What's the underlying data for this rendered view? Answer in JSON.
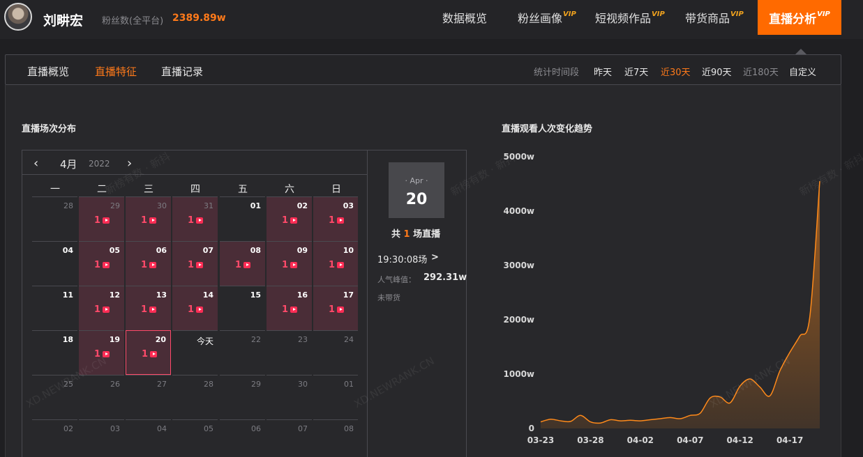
{
  "header": {
    "username": "刘畊宏",
    "fans_label": "粉丝数(全平台)",
    "fans_value": "2389.89w",
    "nav": [
      {
        "label": "数据概览",
        "vip": ""
      },
      {
        "label": "粉丝画像",
        "vip": "VIP"
      },
      {
        "label": "短视频作品",
        "vip": "VIP"
      },
      {
        "label": "带货商品",
        "vip": "VIP"
      },
      {
        "label": "直播分析",
        "vip": "VIP"
      }
    ]
  },
  "subnav": {
    "tabs": [
      "直播概览",
      "直播特征",
      "直播记录"
    ],
    "range_label": "统计时间段",
    "ranges": [
      "昨天",
      "近7天",
      "近30天",
      "近90天",
      "近180天",
      "自定义"
    ]
  },
  "calendar": {
    "title": "直播场次分布",
    "prev": "‹",
    "next": "›",
    "month": "4月",
    "year": "2022",
    "weekdays": [
      "一",
      "二",
      "三",
      "四",
      "五",
      "六",
      "日"
    ],
    "today_label": "今天",
    "live_count": "1",
    "days": [
      {
        "n": "28",
        "faded": true,
        "live": false
      },
      {
        "n": "29",
        "faded": true,
        "live": true
      },
      {
        "n": "30",
        "faded": true,
        "live": true
      },
      {
        "n": "31",
        "faded": true,
        "live": true
      },
      {
        "n": "01",
        "faded": false,
        "live": false
      },
      {
        "n": "02",
        "faded": false,
        "live": true
      },
      {
        "n": "03",
        "faded": false,
        "live": true
      },
      {
        "n": "04",
        "faded": false,
        "live": false
      },
      {
        "n": "05",
        "faded": false,
        "live": true
      },
      {
        "n": "06",
        "faded": false,
        "live": true
      },
      {
        "n": "07",
        "faded": false,
        "live": true
      },
      {
        "n": "08",
        "faded": false,
        "live": true
      },
      {
        "n": "09",
        "faded": false,
        "live": true
      },
      {
        "n": "10",
        "faded": false,
        "live": true
      },
      {
        "n": "11",
        "faded": false,
        "live": false
      },
      {
        "n": "12",
        "faded": false,
        "live": true
      },
      {
        "n": "13",
        "faded": false,
        "live": true
      },
      {
        "n": "14",
        "faded": false,
        "live": true
      },
      {
        "n": "15",
        "faded": false,
        "live": false
      },
      {
        "n": "16",
        "faded": false,
        "live": true
      },
      {
        "n": "17",
        "faded": false,
        "live": true
      },
      {
        "n": "18",
        "faded": false,
        "live": false
      },
      {
        "n": "19",
        "faded": false,
        "live": true
      },
      {
        "n": "20",
        "faded": false,
        "live": true,
        "selected": true
      },
      {
        "n": "今天",
        "faded": false,
        "live": false,
        "today": true
      },
      {
        "n": "22",
        "faded": true,
        "live": false
      },
      {
        "n": "23",
        "faded": true,
        "live": false
      },
      {
        "n": "24",
        "faded": true,
        "live": false
      },
      {
        "n": "25",
        "faded": true,
        "live": false
      },
      {
        "n": "26",
        "faded": true,
        "live": false
      },
      {
        "n": "27",
        "faded": true,
        "live": false
      },
      {
        "n": "28",
        "faded": true,
        "live": false
      },
      {
        "n": "29",
        "faded": true,
        "live": false
      },
      {
        "n": "30",
        "faded": true,
        "live": false
      },
      {
        "n": "01",
        "faded": true,
        "live": false
      },
      {
        "n": "02",
        "faded": true,
        "live": false
      },
      {
        "n": "03",
        "faded": true,
        "live": false
      },
      {
        "n": "04",
        "faded": true,
        "live": false
      },
      {
        "n": "05",
        "faded": true,
        "live": false
      },
      {
        "n": "06",
        "faded": true,
        "live": false
      },
      {
        "n": "07",
        "faded": true,
        "live": false
      },
      {
        "n": "08",
        "faded": true,
        "live": false
      }
    ]
  },
  "detail": {
    "month": "· Apr ·",
    "day": "20",
    "total_prefix": "共",
    "total_count": "1",
    "total_suffix": "场直播",
    "session": "19:30:08场",
    "session_arrow": ">",
    "peak_label": "人气峰值：",
    "peak_value": "292.31w",
    "no_goods": "未带货"
  },
  "watermarks": {
    "brand": "新榜有数 · 新抖",
    "url": "XD.NEWRANK.CN"
  },
  "chart_data": {
    "type": "area",
    "title": "直播观看人次变化趋势",
    "unit": "w",
    "ylim": [
      0,
      5000
    ],
    "yticks": [
      "0",
      "1000w",
      "2000w",
      "3000w",
      "4000w",
      "5000w"
    ],
    "xticks": [
      "03-23",
      "03-28",
      "04-02",
      "04-07",
      "04-12",
      "04-17"
    ],
    "color": "#ff8a1a",
    "x": [
      "03-23",
      "03-24",
      "03-25",
      "03-26",
      "03-27",
      "03-28",
      "03-29",
      "03-30",
      "03-31",
      "04-01",
      "04-02",
      "04-03",
      "04-04",
      "04-05",
      "04-06",
      "04-07",
      "04-08",
      "04-09",
      "04-10",
      "04-11",
      "04-12",
      "04-13",
      "04-14",
      "04-15",
      "04-16",
      "04-17",
      "04-18",
      "04-19",
      "04-20"
    ],
    "values": [
      120,
      170,
      140,
      130,
      240,
      120,
      100,
      160,
      140,
      150,
      140,
      160,
      180,
      200,
      180,
      240,
      280,
      560,
      580,
      470,
      780,
      910,
      760,
      600,
      1060,
      1400,
      1700,
      2050,
      4550
    ]
  }
}
